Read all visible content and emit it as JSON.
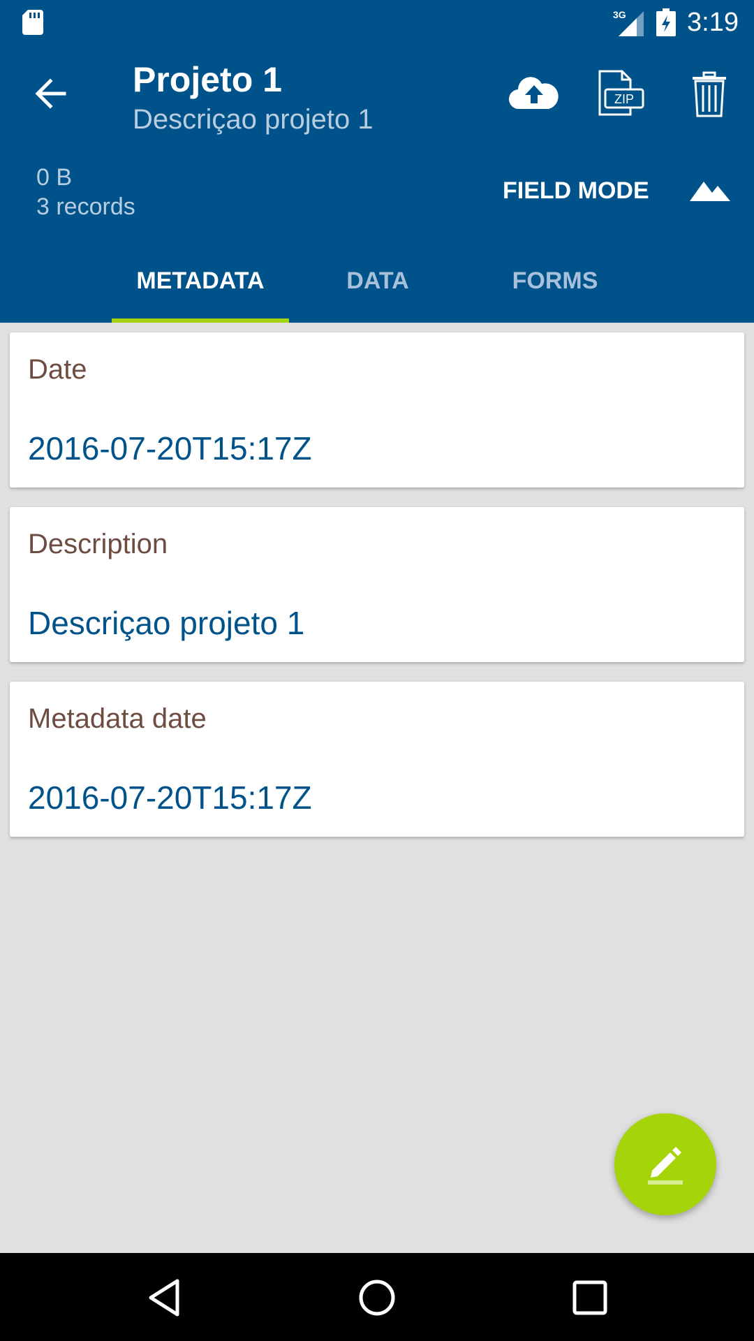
{
  "status_bar": {
    "time": "3:19",
    "network_label": "3G",
    "icons": [
      "sd-card-icon",
      "signal-icon",
      "battery-icon"
    ]
  },
  "header": {
    "title": "Projeto 1",
    "subtitle": "Descriçao projeto 1",
    "size": "0 B",
    "records": "3 records",
    "field_mode_label": "FIELD MODE",
    "actions": [
      "upload-icon",
      "zip-icon",
      "trash-icon"
    ]
  },
  "tabs": [
    {
      "label": "METADATA",
      "active": true
    },
    {
      "label": "DATA",
      "active": false
    },
    {
      "label": "FORMS",
      "active": false
    }
  ],
  "metadata": [
    {
      "label": "Date",
      "value": "2016-07-20T15:17Z"
    },
    {
      "label": "Description",
      "value": "Descriçao projeto 1"
    },
    {
      "label": "Metadata date",
      "value": "2016-07-20T15:17Z"
    }
  ],
  "fab": {
    "icon": "edit-icon"
  },
  "colors": {
    "primary": "#00538a",
    "accent": "#a6d40a",
    "label": "#6d4c41",
    "background": "#e0e0e0"
  }
}
